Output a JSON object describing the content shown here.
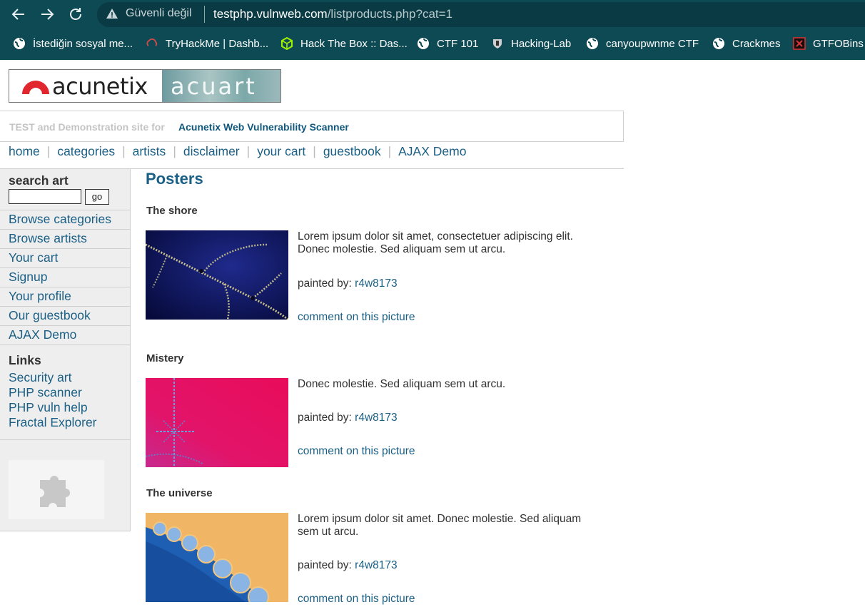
{
  "browser": {
    "security_label": "Güvenli değil",
    "url_host": "testphp.vulnweb.com",
    "url_path": "/listproducts.php?cat=1",
    "bookmarks": [
      {
        "label": "İstediğin sosyal me...",
        "icon": "globe-icon"
      },
      {
        "label": "TryHackMe | Dashb...",
        "icon": "tryhackme-icon"
      },
      {
        "label": "Hack The Box :: Das...",
        "icon": "hackthebox-icon"
      },
      {
        "label": "CTF 101",
        "icon": "globe-icon"
      },
      {
        "label": "Hacking-Lab",
        "icon": "hackinglab-icon"
      },
      {
        "label": "canyoupwnme CTF",
        "icon": "globe-icon"
      },
      {
        "label": "Crackmes",
        "icon": "globe-icon"
      },
      {
        "label": "GTFOBins",
        "icon": "gtfobins-icon"
      }
    ]
  },
  "site": {
    "logo_left": "acunetix",
    "logo_right": "acuart",
    "tagline_grey": "TEST and Demonstration site for",
    "tagline_blue": "Acunetix Web Vulnerability Scanner"
  },
  "topnav": [
    "home",
    "categories",
    "artists",
    "disclaimer",
    "your cart",
    "guestbook",
    "AJAX Demo"
  ],
  "sidebar": {
    "search_title": "search art",
    "go_label": "go",
    "search_value": "",
    "items": [
      "Browse categories",
      "Browse artists",
      "Your cart",
      "Signup",
      "Your profile",
      "Our guestbook",
      "AJAX Demo"
    ],
    "links_title": "Links",
    "links": [
      "Security art",
      "PHP scanner",
      "PHP vuln help",
      "Fractal Explorer"
    ]
  },
  "main": {
    "title": "Posters",
    "painted_by_label": "painted by:",
    "comment_label": "comment on this picture",
    "products": [
      {
        "title": "The shore",
        "description": "Lorem ipsum dolor sit amet, consectetuer adipiscing elit. Donec molestie. Sed aliquam sem ut arcu.",
        "artist": "r4w8173"
      },
      {
        "title": "Mistery",
        "description": "Donec molestie. Sed aliquam sem ut arcu.",
        "artist": "r4w8173"
      },
      {
        "title": "The universe",
        "description": "Lorem ipsum dolor sit amet. Donec molestie. Sed aliquam sem ut arcu.",
        "artist": "r4w8173"
      }
    ]
  },
  "colors": {
    "chrome_bg": "#0e4a54",
    "link_blue": "#1a5f85",
    "sidebar_bg": "#eeeeee"
  }
}
